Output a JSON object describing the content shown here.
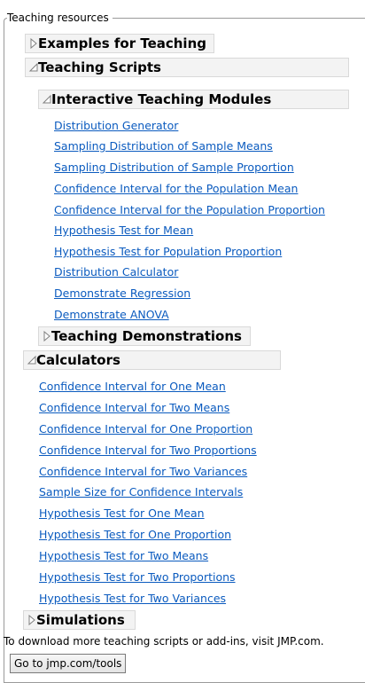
{
  "group": {
    "legend": "Teaching resources"
  },
  "sections": {
    "examples": {
      "label": "Examples for Teaching",
      "state": "collapsed"
    },
    "scripts": {
      "label": "Teaching Scripts",
      "state": "expanded"
    },
    "modules": {
      "label": "Interactive Teaching Modules",
      "state": "expanded"
    },
    "demonstrations": {
      "label": "Teaching Demonstrations",
      "state": "collapsed"
    },
    "calculators": {
      "label": "Calculators",
      "state": "expanded"
    },
    "simulations": {
      "label": "Simulations",
      "state": "collapsed"
    }
  },
  "modules_links": [
    "Distribution Generator",
    "Sampling Distribution of Sample Means",
    "Sampling Distribution of Sample Proportion",
    "Confidence Interval for the Population Mean",
    "Confidence Interval for the Population Proportion",
    "Hypothesis Test for Mean",
    "Hypothesis Test for Population Proportion",
    "Distribution Calculator",
    "Demonstrate Regression",
    "Demonstrate ANOVA"
  ],
  "calculator_links": [
    "Confidence Interval for One Mean",
    "Confidence Interval for Two Means",
    "Confidence Interval for One Proportion",
    "Confidence Interval for Two Proportions",
    "Confidence Interval for Two Variances",
    "Sample Size for Confidence Intervals",
    "Hypothesis Test for One Mean",
    "Hypothesis Test for One Proportion",
    "Hypothesis Test for Two Means",
    "Hypothesis Test for Two Proportions",
    "Hypothesis Test for Two Variances"
  ],
  "footer": {
    "note": "To download more teaching scripts or add-ins, visit JMP.com.",
    "button_label": "Go to jmp.com/tools"
  },
  "colors": {
    "link": "#0b5bbf",
    "header_bg": "#f3f3f3",
    "border": "#d9d9d9"
  }
}
